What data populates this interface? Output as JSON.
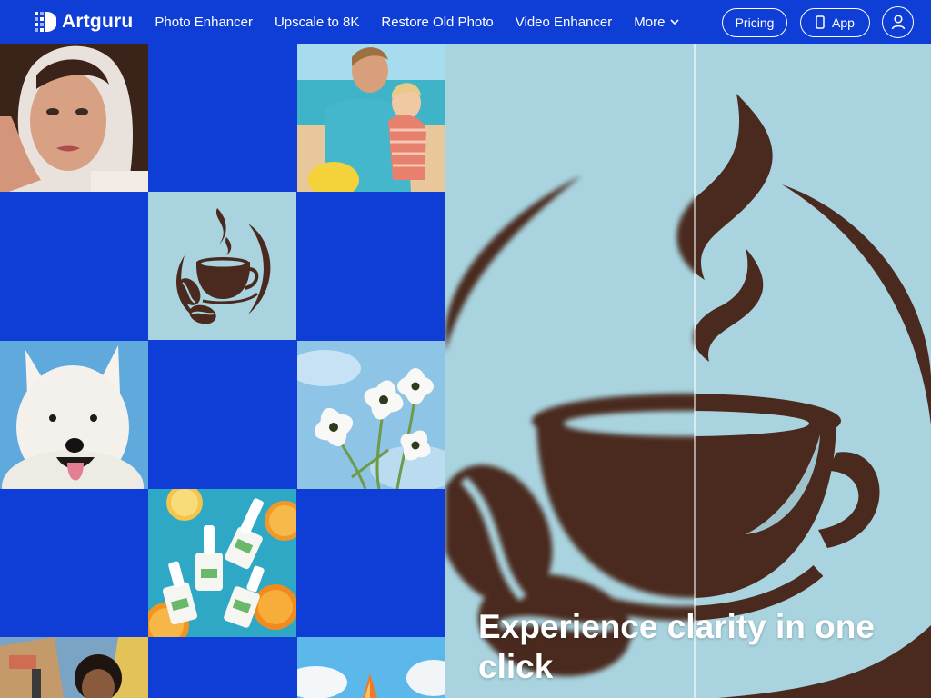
{
  "header": {
    "logo_text": "Artguru",
    "nav": [
      "Photo Enhancer",
      "Upscale to 8K",
      "Restore Old Photo",
      "Video Enhancer",
      "More"
    ],
    "pricing_label": "Pricing",
    "app_label": "App"
  },
  "colors": {
    "brand_blue": "#0e3ed6",
    "hero_bg": "#a9d4df",
    "coffee_brown": "#4a2a1e"
  },
  "grid": {
    "tiles": [
      {
        "name": "portrait-woman-photo"
      },
      {
        "name": "mother-child-beach-photo"
      },
      {
        "name": "coffee-logo-thumbnail"
      },
      {
        "name": "white-dog-photo"
      },
      {
        "name": "daisies-sky-photo"
      },
      {
        "name": "nail-polish-citrus-photo"
      },
      {
        "name": "street-portrait-photo"
      },
      {
        "name": "sailboat-photo"
      }
    ]
  },
  "hero": {
    "headline": "Experience clarity in one click",
    "icons": [
      "coffee-cup-logo"
    ]
  }
}
